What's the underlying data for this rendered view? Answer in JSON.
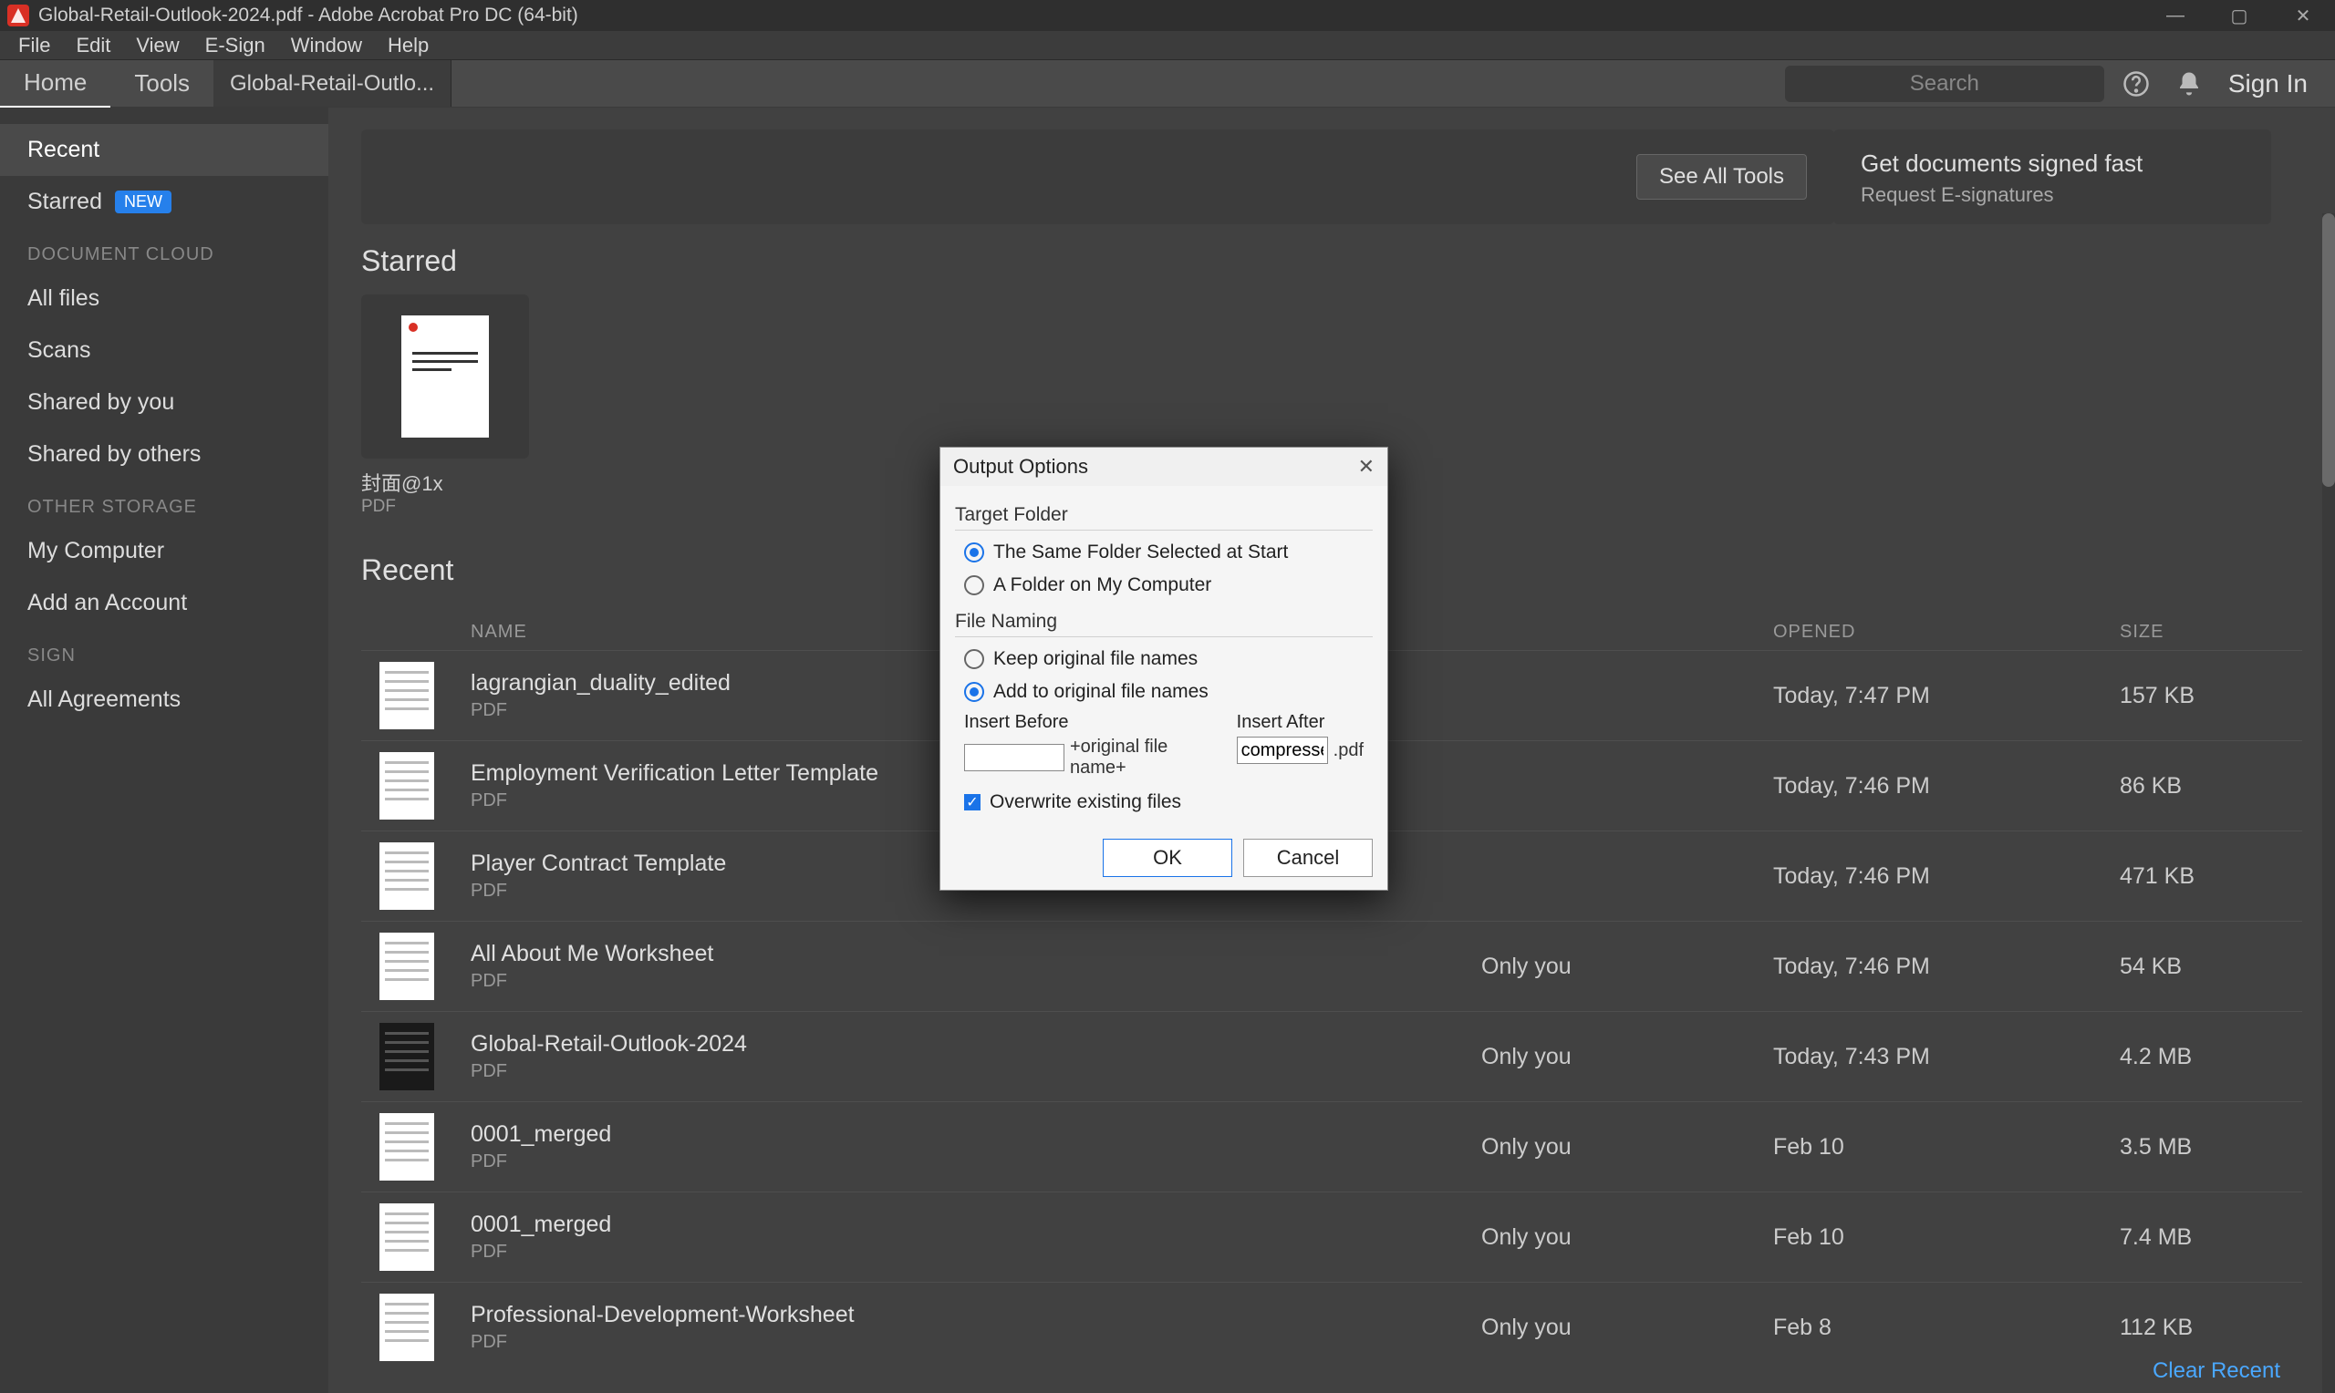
{
  "titlebar": {
    "title": "Global-Retail-Outlook-2024.pdf - Adobe Acrobat Pro DC (64-bit)"
  },
  "menubar": [
    "File",
    "Edit",
    "View",
    "E-Sign",
    "Window",
    "Help"
  ],
  "toptabs": {
    "home": "Home",
    "tools": "Tools",
    "doc_tab": "Global-Retail-Outlo...",
    "search_placeholder": "Search",
    "signin": "Sign In"
  },
  "sidebar": {
    "recent": "Recent",
    "starred": "Starred",
    "new_badge": "NEW",
    "heading_doc_cloud": "DOCUMENT CLOUD",
    "all_files": "All files",
    "scans": "Scans",
    "shared_by_you": "Shared by you",
    "shared_by_others": "Shared by others",
    "heading_other": "OTHER STORAGE",
    "my_computer": "My Computer",
    "add_account": "Add an Account",
    "heading_sign": "SIGN",
    "all_agreements": "All Agreements"
  },
  "content": {
    "see_all_tools": "See All Tools",
    "signed_title": "Get documents signed fast",
    "signed_sub": "Request E-signatures",
    "starred_title": "Starred",
    "starred_thumb_name": "封面@1x",
    "starred_thumb_type": "PDF",
    "recent_title": "Recent",
    "columns": {
      "name": "NAME",
      "opened": "OPENED",
      "size": "SIZE"
    },
    "rows": [
      {
        "name": "lagrangian_duality_edited",
        "type": "PDF",
        "owner": "",
        "opened": "Today, 7:47 PM",
        "size": "157 KB",
        "icon": "light"
      },
      {
        "name": "Employment Verification Letter Template",
        "type": "PDF",
        "owner": "",
        "opened": "Today, 7:46 PM",
        "size": "86 KB",
        "icon": "light"
      },
      {
        "name": "Player Contract Template",
        "type": "PDF",
        "owner": "",
        "opened": "Today, 7:46 PM",
        "size": "471 KB",
        "icon": "light"
      },
      {
        "name": "All About Me Worksheet",
        "type": "PDF",
        "owner": "Only you",
        "opened": "Today, 7:46 PM",
        "size": "54 KB",
        "icon": "light"
      },
      {
        "name": "Global-Retail-Outlook-2024",
        "type": "PDF",
        "owner": "Only you",
        "opened": "Today, 7:43 PM",
        "size": "4.2 MB",
        "icon": "dark"
      },
      {
        "name": "0001_merged",
        "type": "PDF",
        "owner": "Only you",
        "opened": "Feb 10",
        "size": "3.5 MB",
        "icon": "light"
      },
      {
        "name": "0001_merged",
        "type": "PDF",
        "owner": "Only you",
        "opened": "Feb 10",
        "size": "7.4 MB",
        "icon": "light"
      },
      {
        "name": "Professional-Development-Worksheet",
        "type": "PDF",
        "owner": "Only you",
        "opened": "Feb 8",
        "size": "112 KB",
        "icon": "light"
      }
    ],
    "clear_recent": "Clear Recent"
  },
  "dialog": {
    "title": "Output Options",
    "target_folder_label": "Target Folder",
    "target_same": "The Same Folder Selected at Start",
    "target_my": "A Folder on My Computer",
    "file_naming_label": "File Naming",
    "keep_original": "Keep original file names",
    "add_original": "Add to original file names",
    "insert_before": "Insert Before",
    "insert_after": "Insert After",
    "insert_before_value": "",
    "original_file_name_label": "+original file name+",
    "insert_after_value": "compresse",
    "pdf_ext": ".pdf",
    "overwrite": "Overwrite existing files",
    "ok": "OK",
    "cancel": "Cancel"
  }
}
